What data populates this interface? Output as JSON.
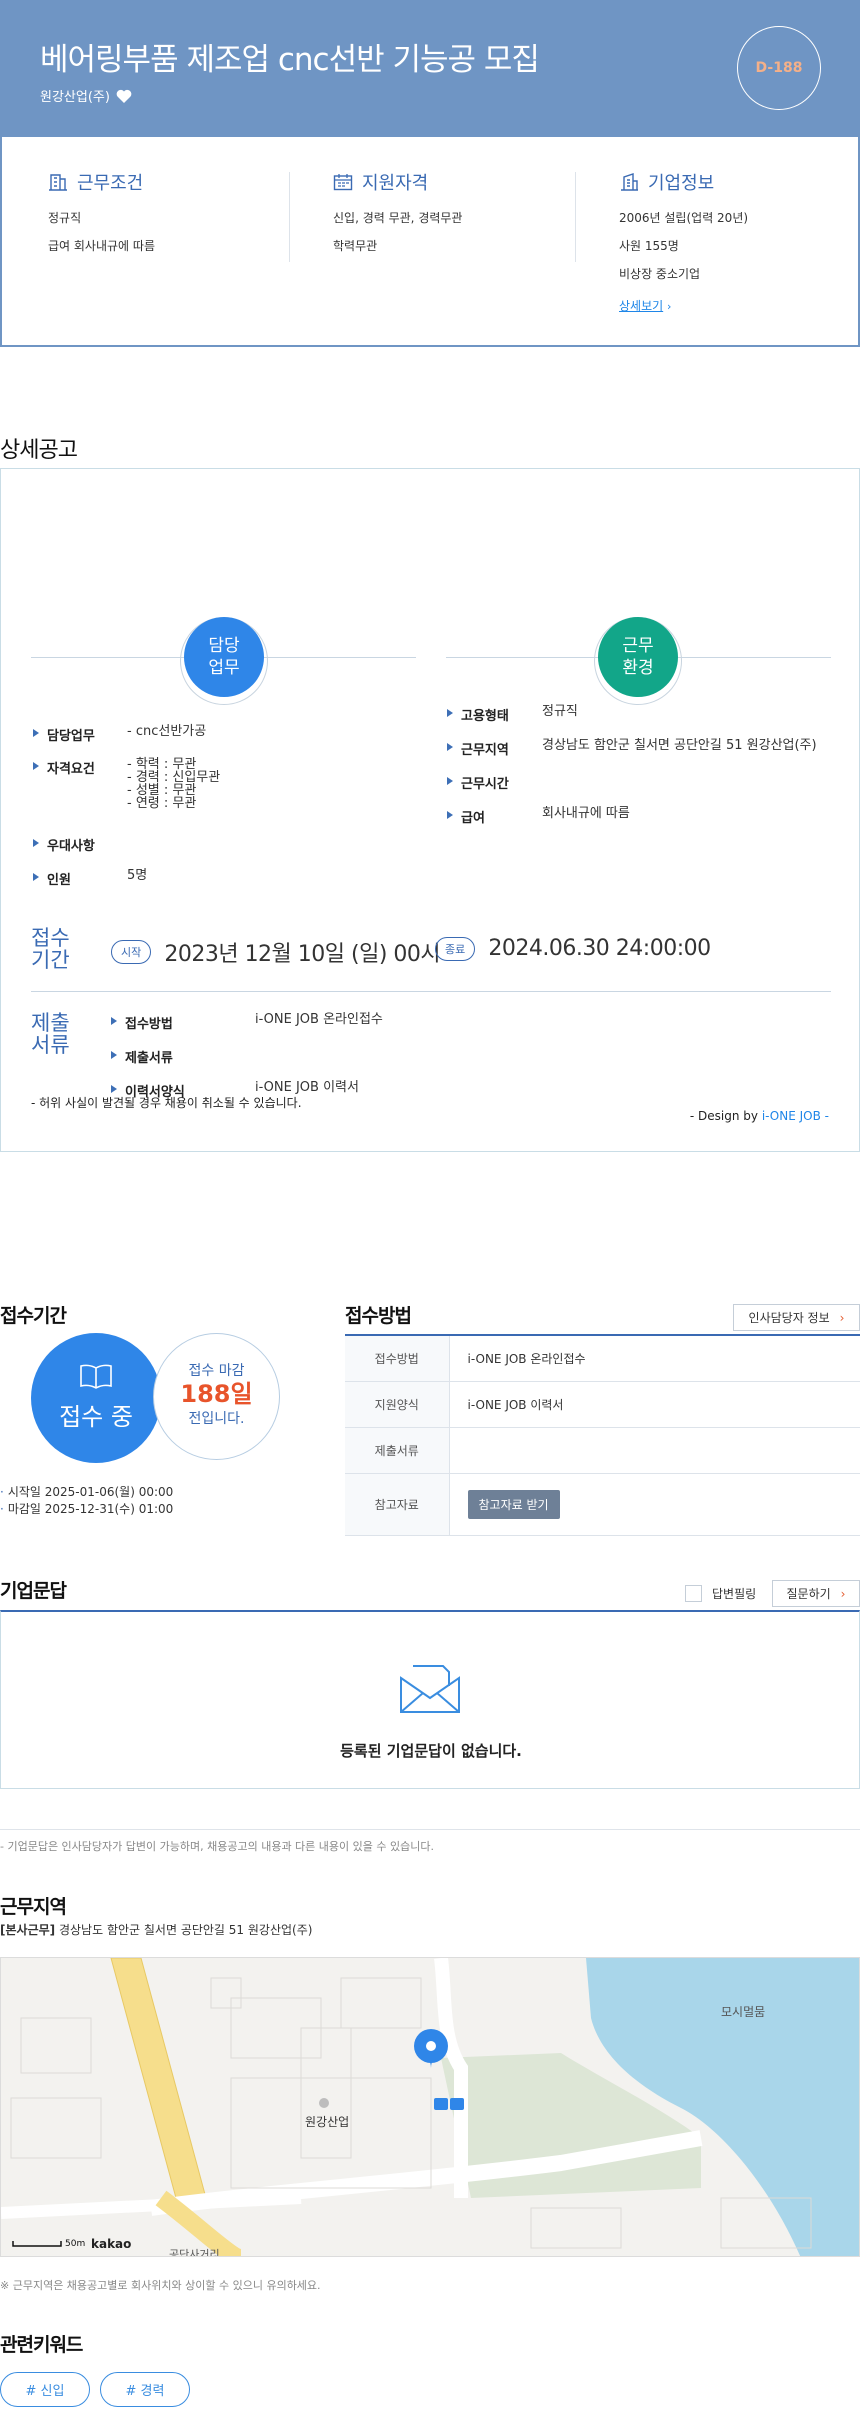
{
  "header": {
    "title": "베어링부품 제조업 cnc선반 기능공 모집",
    "company": "원강산업(주)",
    "dday": "D-188"
  },
  "summary": {
    "conditions": {
      "title": "근무조건",
      "lines": [
        "정규직",
        "급여 회사내규에 따름"
      ]
    },
    "qualifications": {
      "title": "지원자격",
      "lines": [
        "신입, 경력 무관, 경력무관",
        "학력무관"
      ]
    },
    "company_info": {
      "title": "기업정보",
      "lines": [
        "2006년 설립(업력 20년)",
        "사원 155명",
        "비상장 중소기업"
      ],
      "more": "상세보기"
    }
  },
  "detail": {
    "heading": "상세공고",
    "duty_circle": "담당\n업무",
    "env_circle": "근무\n환경",
    "left_rows": [
      {
        "k": "담당업무",
        "v": "- cnc선반가공"
      },
      {
        "k": "자격요건",
        "v": "- 학력 : 무관\n- 경력 : 신입무관\n- 성별 : 무관\n- 연령 : 무관"
      },
      {
        "k": "우대사항",
        "v": ""
      },
      {
        "k": "인원",
        "v": "5명"
      }
    ],
    "right_rows": [
      {
        "k": "고용형태",
        "v": "정규직"
      },
      {
        "k": "근무지역",
        "v": "경상남도 함안군 칠서면 공단안길 51 원강산업(주)"
      },
      {
        "k": "근무시간",
        "v": ""
      },
      {
        "k": "급여",
        "v": "회사내규에 따름"
      }
    ],
    "period_label": "접수\n기간",
    "start_pill": "시작",
    "start_date": "2023년 12월 10일 (일) 00시",
    "end_pill": "종료",
    "end_date": "2024.06.30 24:00:00",
    "docs_label": "제출\n서류",
    "docs_rows": [
      {
        "k": "접수방법",
        "v": "i-ONE JOB 온라인접수"
      },
      {
        "k": "제출서류",
        "v": ""
      },
      {
        "k": "이력서양식",
        "v": "i-ONE JOB 이력서"
      }
    ],
    "warning": "- 허위 사실이 발견될 경우 채용이 취소될 수 있습니다.",
    "design_prefix": "- Design by ",
    "design_brand": "i-ONE JOB -"
  },
  "apply": {
    "period_title": "접수기간",
    "status": "접수 중",
    "deadline_label": "접수 마감",
    "deadline_days": "188일",
    "deadline_suffix": "전입니다.",
    "start": "시작일 2025-01-06(월) 00:00",
    "end": "마감일 2025-12-31(수) 01:00",
    "method_title": "접수방법",
    "hr_button": "인사담당자 정보",
    "table": [
      {
        "label": "접수방법",
        "value": "i-ONE JOB 온라인접수"
      },
      {
        "label": "지원양식",
        "value": "i-ONE JOB 이력서"
      },
      {
        "label": "제출서류",
        "value": ""
      },
      {
        "label": "참고자료",
        "value": "참고자료 받기"
      }
    ]
  },
  "qna": {
    "title": "기업문답",
    "answered_label": "답변필링",
    "ask_button": "질문하기",
    "empty": "등록된 기업문답이 없습니다.",
    "note": "- 기업문답은 인사담당자가 답변이 가능하며, 채용공고의 내용과 다른 내용이 있을 수 있습니다."
  },
  "location": {
    "title": "근무지역",
    "tag": "[본사근무]",
    "address": "경상남도 함안군 칠서면 공단안길 51 원강산업(주)",
    "map_company": "원강산업",
    "map_lake": "모시멀뭄",
    "map_cross": "공단사거리",
    "map_scale": "50m",
    "map_brand": "kakao",
    "note": "※ 근무지역은 채용공고별로 회사위치와 상이할 수 있으니 유의하세요."
  },
  "keywords": {
    "title": "관련키워드",
    "items": [
      "# 신입",
      "# 경력"
    ]
  },
  "colors": {
    "header_bg": "#6f95c4",
    "accent": "#2f86e8",
    "green": "#12a689",
    "deadline": "#e8542b"
  }
}
